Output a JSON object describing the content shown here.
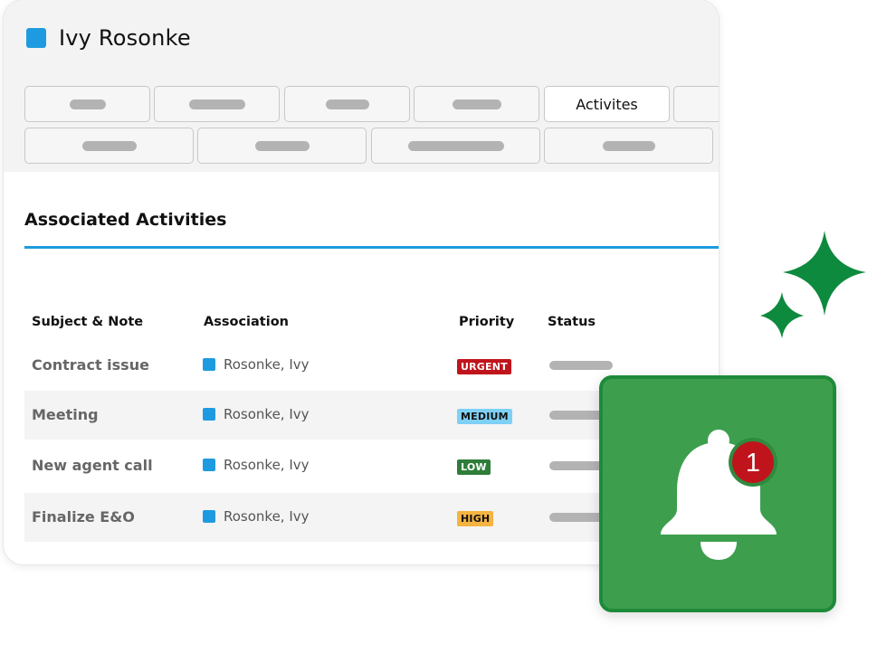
{
  "record": {
    "title": "Ivy Rosonke"
  },
  "tabs": {
    "active_label": "Activites"
  },
  "section": {
    "title": "Associated Activities"
  },
  "table": {
    "headers": [
      "Subject & Note",
      "Association",
      "Priority",
      "Status"
    ],
    "rows": [
      {
        "subject": "Contract issue",
        "association": "Rosonke, Ivy",
        "priority": "URGENT"
      },
      {
        "subject": "Meeting",
        "association": "Rosonke, Ivy",
        "priority": "MEDIUM"
      },
      {
        "subject": "New agent call",
        "association": "Rosonke, Ivy",
        "priority": "LOW"
      },
      {
        "subject": "Finalize E&O",
        "association": "Rosonke, Ivy",
        "priority": "HIGH"
      }
    ]
  },
  "notification": {
    "count": "1"
  },
  "colors": {
    "accent": "#1e9be0",
    "urgent": "#c0141c",
    "medium": "#7fd0f5",
    "low": "#2e7d3a",
    "high": "#f5b342",
    "notification_bg": "#3d9f4d",
    "sparkle": "#0e8a3e"
  },
  "icons": {
    "record": "blue-square-icon",
    "notification": "bell-icon",
    "decoration": "sparkle-icon"
  }
}
